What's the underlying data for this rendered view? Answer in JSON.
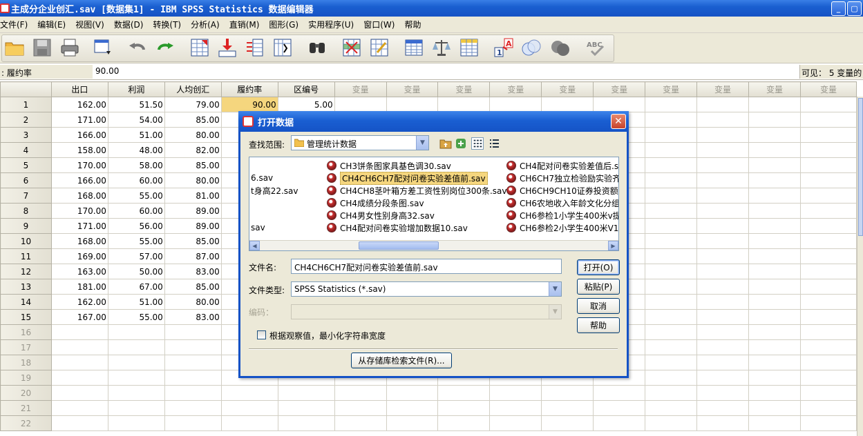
{
  "window": {
    "title": "主成分企业创汇.sav [数据集1] - IBM SPSS Statistics 数据编辑器"
  },
  "menu": [
    "文件(F)",
    "编辑(E)",
    "视图(V)",
    "数据(D)",
    "转换(T)",
    "分析(A)",
    "直销(M)",
    "图形(G)",
    "实用程序(U)",
    "窗口(W)",
    "帮助"
  ],
  "toolbar": {
    "icons": [
      "open-folder-icon",
      "save-icon",
      "print-icon",
      "dialog-recall-icon",
      "undo-icon",
      "redo-icon",
      "goto-case-icon",
      "goto-variable-icon",
      "variables-icon",
      "run-descriptive-icon",
      "find-icon",
      "insert-cases-icon",
      "insert-variable-icon",
      "split-file-icon",
      "weight-cases-icon",
      "select-cases-icon",
      "value-labels-icon",
      "use-sets-icon",
      "show-all-variables-icon",
      "spell-check-icon"
    ]
  },
  "cellbar": {
    "ref": ": 履约率",
    "value": "90.00",
    "visible": "可见： 5 变量的"
  },
  "grid": {
    "columns": [
      "出口",
      "利润",
      "人均创汇",
      "履约率",
      "区编号"
    ],
    "empty_column_label": "变量",
    "rows": [
      [
        "1",
        "162.00",
        "51.50",
        "79.00",
        "90.00",
        "5.00"
      ],
      [
        "2",
        "171.00",
        "54.00",
        "85.00",
        "",
        ""
      ],
      [
        "3",
        "166.00",
        "51.00",
        "80.00",
        "",
        ""
      ],
      [
        "4",
        "158.00",
        "48.00",
        "82.00",
        "",
        ""
      ],
      [
        "5",
        "170.00",
        "58.00",
        "85.00",
        "",
        ""
      ],
      [
        "6",
        "166.00",
        "60.00",
        "80.00",
        "",
        ""
      ],
      [
        "7",
        "168.00",
        "55.00",
        "81.00",
        "",
        ""
      ],
      [
        "8",
        "170.00",
        "60.00",
        "89.00",
        "",
        ""
      ],
      [
        "9",
        "171.00",
        "56.00",
        "89.00",
        "",
        ""
      ],
      [
        "10",
        "168.00",
        "55.00",
        "85.00",
        "",
        ""
      ],
      [
        "11",
        "169.00",
        "57.00",
        "87.00",
        "",
        ""
      ],
      [
        "12",
        "163.00",
        "50.00",
        "83.00",
        "",
        ""
      ],
      [
        "13",
        "181.00",
        "67.00",
        "85.00",
        "",
        ""
      ],
      [
        "14",
        "162.00",
        "51.00",
        "80.00",
        "",
        ""
      ],
      [
        "15",
        "167.00",
        "55.00",
        "83.00",
        "",
        ""
      ]
    ],
    "empty_rows": [
      "16",
      "17",
      "18",
      "19",
      "20",
      "21",
      "22"
    ]
  },
  "dialog": {
    "title": "打开数据",
    "look_in_label": "查找范围:",
    "look_in_value": "管理统计数据",
    "files_col0": [
      "6.sav",
      "t身高22.sav",
      "sav"
    ],
    "files_col1": [
      "CH3饼条图家具基色调30.sav",
      "CH4CH6CH7配对问卷实验差值前.sav",
      "CH4CH8茎叶箱方差工资性别岗位300条.sav",
      "CH4成绩分段条图.sav",
      "CH4男女性别身高32.sav",
      "CH4配对问卷实验增加数据10.sav"
    ],
    "files_col2": [
      "CH4配对问卷实验差值后.s",
      "CH6CH7独立检验励实验齐",
      "CH6CH9CH10证券投资额",
      "CH6农地收入年龄文化分组",
      "CH6参检1小学生400米v提",
      "CH6参检2小学生400米V10"
    ],
    "filename_label": "文件名:",
    "filename_value": "CH4CH6CH7配对问卷实验差值前.sav",
    "filetype_label": "文件类型:",
    "filetype_value": "SPSS Statistics (*.sav)",
    "encoding_label": "编码：",
    "checkbox_label": "根据观察值，最小化字符串宽度",
    "btn_open": "打开(O)",
    "btn_paste": "粘贴(P)",
    "btn_cancel": "取消",
    "btn_help": "帮助",
    "btn_repo": "从存储库检索文件(R)..."
  }
}
